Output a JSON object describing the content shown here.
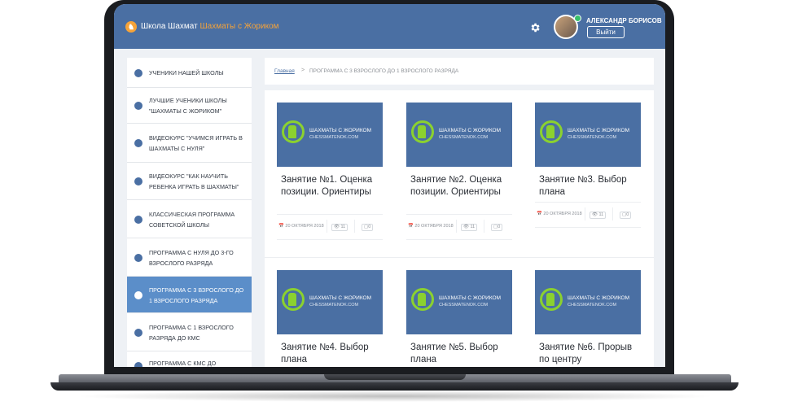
{
  "header": {
    "brand_main": "Школа Шахмат",
    "brand_accent": "Шахматы с Жориком",
    "user_name": "АЛЕКСАНДР БОРИСОВ",
    "logout_label": "Выйти",
    "settings_icon": "gear-icon"
  },
  "sidebar": {
    "items": [
      {
        "label": "УЧЕНИКИ НАШЕЙ ШКОЛЫ",
        "icon": "user-icon"
      },
      {
        "label": "ЛУЧШИЕ УЧЕНИКИ ШКОЛЫ \"ШАХМАТЫ С ЖОРИКОМ\"",
        "icon": "trophy-icon"
      },
      {
        "label": "ВИДЕОКУРС \"УЧИМСЯ ИГРАТЬ В ШАХМАТЫ С НУЛЯ\"",
        "icon": "play-icon"
      },
      {
        "label": "ВИДЕОКУРС \"КАК НАУЧИТЬ РЕБЕНКА ИГРАТЬ В ШАХМАТЫ\"",
        "icon": "play-icon"
      },
      {
        "label": "КЛАССИЧЕСКАЯ ПРОГРАММА СОВЕТСКОЙ ШКОЛЫ",
        "icon": "play-icon"
      },
      {
        "label": "ПРОГРАММА С НУЛЯ ДО 3-ГО ВЗРОСЛОГО РАЗРЯДА",
        "icon": "play-icon"
      },
      {
        "label": "ПРОГРАММА С 3 ВЗРОСЛОГО ДО 1 ВЗРОСЛОГО РАЗРЯДА",
        "icon": "play-icon",
        "active": true
      },
      {
        "label": "ПРОГРАММА С 1 ВЗРОСЛОГО РАЗРЯДА ДО КМС",
        "icon": "play-icon"
      },
      {
        "label": "ПРОГРАММА С КМС ДО",
        "icon": "play-icon"
      }
    ]
  },
  "breadcrumb": {
    "home": "Главная",
    "separator": ">",
    "current": "Программа с 3 взрослого до 1 взрослого разряда"
  },
  "thumbnail": {
    "title": "ШАХМАТЫ С ЖОРИКОМ",
    "site": "CHESSMATENOK.COM"
  },
  "cards": [
    {
      "title": "Занятие №1. Оценка позиции. Ориентиры",
      "date": "20 ОКТЯБРЯ 2018",
      "views": "11",
      "comments": "0"
    },
    {
      "title": "Занятие №2. Оценка позиции. Ориентиры",
      "date": "20 ОКТЯБРЯ 2018",
      "views": "11",
      "comments": "0"
    },
    {
      "title": "Занятие №3. Выбор плана",
      "date": "20 ОКТЯБРЯ 2018",
      "views": "11",
      "comments": "0"
    },
    {
      "title": "Занятие №4. Выбор плана",
      "date": "",
      "views": "",
      "comments": ""
    },
    {
      "title": "Занятие №5. Выбор плана",
      "date": "",
      "views": "",
      "comments": ""
    },
    {
      "title": "Занятие №6. Прорыв по центру",
      "date": "",
      "views": "",
      "comments": ""
    }
  ],
  "colors": {
    "header": "#4a6fa3",
    "accent": "#f5a339",
    "active_item": "#5b8ec9",
    "logo_green": "#8bd12f"
  }
}
